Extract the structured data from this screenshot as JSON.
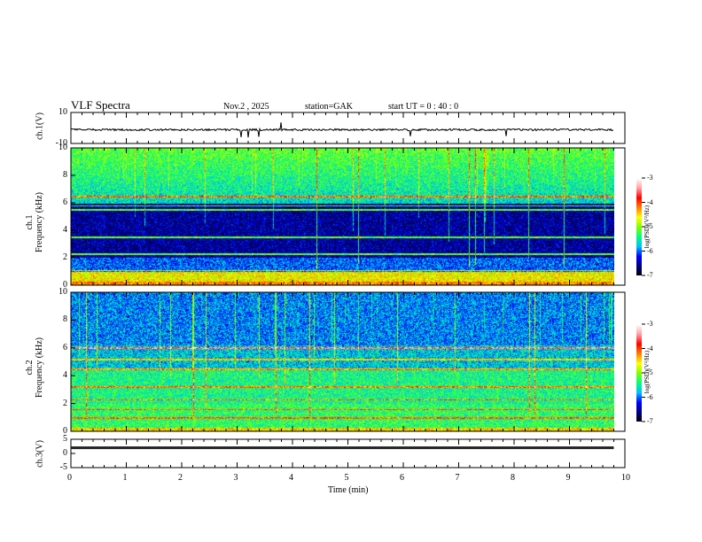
{
  "header": {
    "title": "VLF  Spectra",
    "date": "Nov.2  , 2025",
    "station": "station=GAK",
    "start": "start  UT  =   0  : 40 : 0"
  },
  "chart_data": [
    {
      "type": "line",
      "name_label": "ch.1(V)",
      "ylabel": "ch.1(V)",
      "ylim": [
        -10,
        10
      ],
      "yticks": [
        "10",
        "-10"
      ],
      "baseline": 0,
      "noise": "small fluctuation around 0 V with occasional spikes"
    },
    {
      "type": "heatmap",
      "ylabel_top": "ch.1",
      "ylabel": "Frequency  (kHz)",
      "ylim": [
        0,
        10
      ],
      "yticks": [
        "0",
        "2",
        "4",
        "6",
        "8",
        "10"
      ],
      "colorbar": {
        "label": "log(PSD)(V²/Hz)",
        "range": [
          -7,
          -3
        ],
        "ticks": [
          "-3",
          "-4",
          "-5",
          "-6",
          "-7"
        ]
      }
    },
    {
      "type": "heatmap",
      "ylabel_top": "ch.2",
      "ylabel": "Frequency  (kHz)",
      "ylim": [
        0,
        10
      ],
      "yticks": [
        "0",
        "2",
        "4",
        "6",
        "8",
        "10"
      ],
      "colorbar": {
        "label": "log(PSD)(V²/Hz)",
        "range": [
          -7,
          -3
        ],
        "ticks": [
          "-3",
          "-4",
          "-5",
          "-6",
          "-7"
        ]
      }
    },
    {
      "type": "line",
      "ylabel": "ch.3(V)",
      "ylim": [
        -5,
        5
      ],
      "yticks": [
        "5",
        "0",
        "-5"
      ],
      "baseline": 2
    }
  ],
  "xaxis": {
    "label": "Time  (min)",
    "xlim": [
      0,
      10
    ],
    "data_end": 9.8,
    "ticks": [
      "0",
      "1",
      "2",
      "3",
      "4",
      "5",
      "6",
      "7",
      "8",
      "9",
      "10"
    ]
  },
  "colormap": [
    "#000000",
    "#00007f",
    "#0000ff",
    "#00bfff",
    "#00ff7f",
    "#7fff00",
    "#ffff00",
    "#ff7f00",
    "#ff0000",
    "#ff9f9f",
    "#ffffff"
  ]
}
